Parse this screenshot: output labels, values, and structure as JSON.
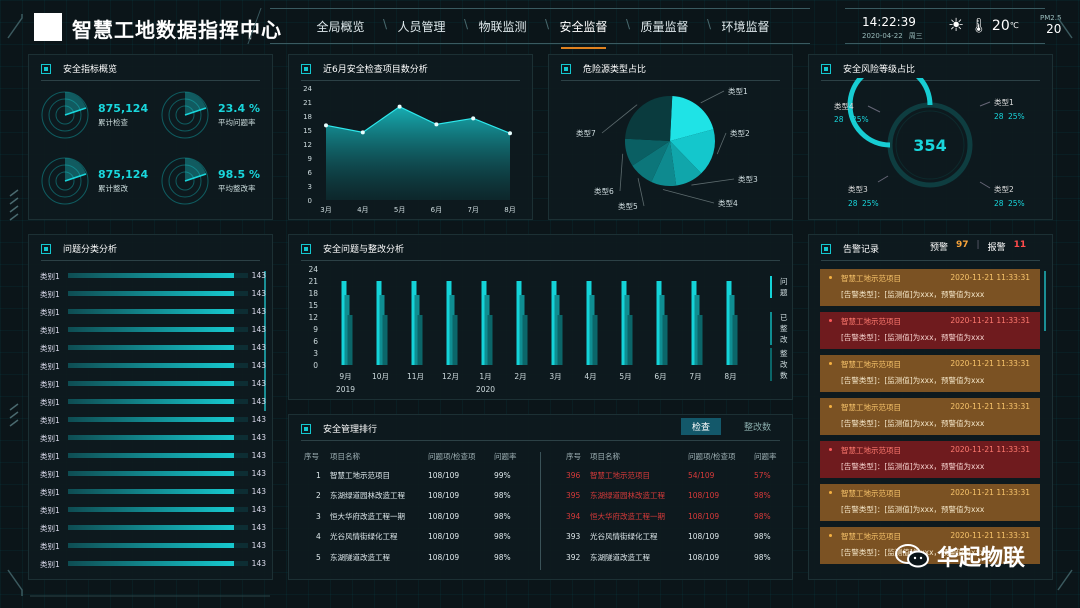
{
  "header": {
    "app_title": "智慧工地数据指挥中心",
    "nav": [
      "全局概览",
      "人员管理",
      "物联监测",
      "安全监督",
      "质量监督",
      "环境监督"
    ],
    "nav_active": 3,
    "time": "14:22:39",
    "date": "2020-04-22",
    "weekday": "周三",
    "temperature": "20",
    "temperature_unit": "℃",
    "pm_label": "PM2.5",
    "pm_value": "20"
  },
  "overview": {
    "title": "安全指标概览",
    "kpis": [
      {
        "value": "875,124",
        "label": "累计检查"
      },
      {
        "value": "23.4 %",
        "label": "平均问题率"
      },
      {
        "value": "875,124",
        "label": "累计整改"
      },
      {
        "value": "98.5 %",
        "label": "平均整改率"
      }
    ]
  },
  "inspections": {
    "title": "近6月安全检查项目数分析",
    "chart_data": {
      "type": "area",
      "categories": [
        "3月",
        "4月",
        "5月",
        "6月",
        "7月",
        "8月"
      ],
      "values": [
        16,
        14.5,
        20,
        16.2,
        17.5,
        14.3
      ],
      "ylim": [
        0,
        24
      ],
      "yticks": [
        0,
        3,
        6,
        9,
        12,
        15,
        18,
        21,
        24
      ]
    }
  },
  "hazard": {
    "title": "危险源类型占比",
    "chart_data": {
      "type": "pie",
      "labels": [
        "类型1",
        "类型2",
        "类型3",
        "类型4",
        "类型5",
        "类型6",
        "类型7"
      ],
      "values": [
        20,
        17,
        10,
        9,
        9,
        10,
        25
      ],
      "colors": [
        "#1fe3e6",
        "#14c7cc",
        "#10a6ab",
        "#0e8a8f",
        "#0c767a",
        "#0a5f63",
        "#0a3b3e"
      ]
    }
  },
  "risk": {
    "title": "安全风险等级占比",
    "center_value": "354",
    "items": [
      {
        "name": "类型1",
        "count": "28",
        "pct": "25%"
      },
      {
        "name": "类型2",
        "count": "28",
        "pct": "25%"
      },
      {
        "name": "类型3",
        "count": "28",
        "pct": "25%"
      },
      {
        "name": "类型4",
        "count": "28",
        "pct": "25%"
      }
    ],
    "progress": 0.75
  },
  "categories": {
    "title": "问题分类分析",
    "rows": [
      {
        "label": "类别1",
        "value": "143",
        "ratio": 0.92
      },
      {
        "label": "类别1",
        "value": "143",
        "ratio": 0.92
      },
      {
        "label": "类别1",
        "value": "143",
        "ratio": 0.92
      },
      {
        "label": "类别1",
        "value": "143",
        "ratio": 0.92
      },
      {
        "label": "类别1",
        "value": "143",
        "ratio": 0.92
      },
      {
        "label": "类别1",
        "value": "143",
        "ratio": 0.92
      },
      {
        "label": "类别1",
        "value": "143",
        "ratio": 0.92
      },
      {
        "label": "类别1",
        "value": "143",
        "ratio": 0.92
      },
      {
        "label": "类别1",
        "value": "143",
        "ratio": 0.92
      },
      {
        "label": "类别1",
        "value": "143",
        "ratio": 0.92
      },
      {
        "label": "类别1",
        "value": "143",
        "ratio": 0.92
      },
      {
        "label": "类别1",
        "value": "143",
        "ratio": 0.92
      },
      {
        "label": "类别1",
        "value": "143",
        "ratio": 0.92
      },
      {
        "label": "类别1",
        "value": "143",
        "ratio": 0.92
      },
      {
        "label": "类别1",
        "value": "143",
        "ratio": 0.92
      },
      {
        "label": "类别1",
        "value": "143",
        "ratio": 0.92
      },
      {
        "label": "类别1",
        "value": "143",
        "ratio": 0.92
      }
    ]
  },
  "issues": {
    "title": "安全问题与整改分析",
    "legend": [
      "问题",
      "已整改",
      "整改数"
    ],
    "chart_data": {
      "type": "bar",
      "categories": [
        "9月",
        "10月",
        "11月",
        "12月",
        "1月",
        "2月",
        "3月",
        "4月",
        "5月",
        "6月",
        "7月",
        "8月"
      ],
      "year_labels": [
        "2019",
        "2020"
      ],
      "series": [
        {
          "name": "问题",
          "values": [
            21,
            21,
            21,
            21,
            21,
            21,
            21,
            21,
            21,
            21,
            21,
            21
          ]
        },
        {
          "name": "已整改",
          "values": [
            17.5,
            17.5,
            17.5,
            17.5,
            17.5,
            17.5,
            17.5,
            17.5,
            17.5,
            17.5,
            17.5,
            17.5
          ]
        },
        {
          "name": "整改数",
          "values": [
            12.5,
            12.5,
            12.5,
            12.5,
            12.5,
            12.5,
            12.5,
            12.5,
            12.5,
            12.5,
            12.5,
            12.5
          ]
        }
      ],
      "ylim": [
        0,
        24
      ],
      "yticks": [
        0,
        3,
        6,
        9,
        12,
        15,
        18,
        21,
        24
      ]
    }
  },
  "ranking": {
    "title": "安全管理排行",
    "tabs": [
      "检查",
      "整改数"
    ],
    "headers": [
      "序号",
      "项目名称",
      "问题项/检查项",
      "问题率"
    ],
    "left_rows": [
      [
        "1",
        "智慧工地示范项目",
        "108/109",
        "99%"
      ],
      [
        "2",
        "东湖绿道园林改造工程",
        "108/109",
        "98%"
      ],
      [
        "3",
        "恒大华府改造工程一期",
        "108/109",
        "98%"
      ],
      [
        "4",
        "光谷风情街绿化工程",
        "108/109",
        "98%"
      ],
      [
        "5",
        "东湖隧道改造工程",
        "108/109",
        "98%"
      ]
    ],
    "right_rows": [
      [
        "396",
        "智慧工地示范项目",
        "54/109",
        "57%"
      ],
      [
        "395",
        "东湖绿道园林改造工程",
        "108/109",
        "98%"
      ],
      [
        "394",
        "恒大华府改造工程一期",
        "108/109",
        "98%"
      ],
      [
        "393",
        "光谷风情街绿化工程",
        "108/109",
        "98%"
      ],
      [
        "392",
        "东湖隧道改造工程",
        "108/109",
        "98%"
      ]
    ],
    "right_red_rows": 3
  },
  "alerts": {
    "title": "告警记录",
    "warn_label": "预警",
    "warn_count": "97",
    "alarm_label": "报警",
    "alarm_count": "11",
    "items": [
      {
        "kind": "warn",
        "project": "智慧工地示范项目",
        "time": "2020-11-21 11:33:31",
        "detail": "[告警类型]：[监测值]为xxx，预警值为xxx"
      },
      {
        "kind": "alarm",
        "project": "智慧工地示范项目",
        "time": "2020-11-21 11:33:31",
        "detail": "[告警类型]：[监测值]为xxx，预警值为xxx"
      },
      {
        "kind": "warn",
        "project": "智慧工地示范项目",
        "time": "2020-11-21 11:33:31",
        "detail": "[告警类型]：[监测值]为xxx，预警值为xxx"
      },
      {
        "kind": "warn",
        "project": "智慧工地示范项目",
        "time": "2020-11-21 11:33:31",
        "detail": "[告警类型]：[监测值]为xxx，预警值为xxx"
      },
      {
        "kind": "alarm",
        "project": "智慧工地示范项目",
        "time": "2020-11-21 11:33:31",
        "detail": "[告警类型]：[监测值]为xxx，预警值为xxx"
      },
      {
        "kind": "warn",
        "project": "智慧工地示范项目",
        "time": "2020-11-21 11:33:31",
        "detail": "[告警类型]：[监测值]为xxx，预警值为xxx"
      },
      {
        "kind": "warn",
        "project": "智慧工地示范项目",
        "time": "2020-11-21 11:33:31",
        "detail": "[告警类型]：[监测值]为xxx，预警值为xxx"
      }
    ]
  },
  "watermark": "华起物联"
}
